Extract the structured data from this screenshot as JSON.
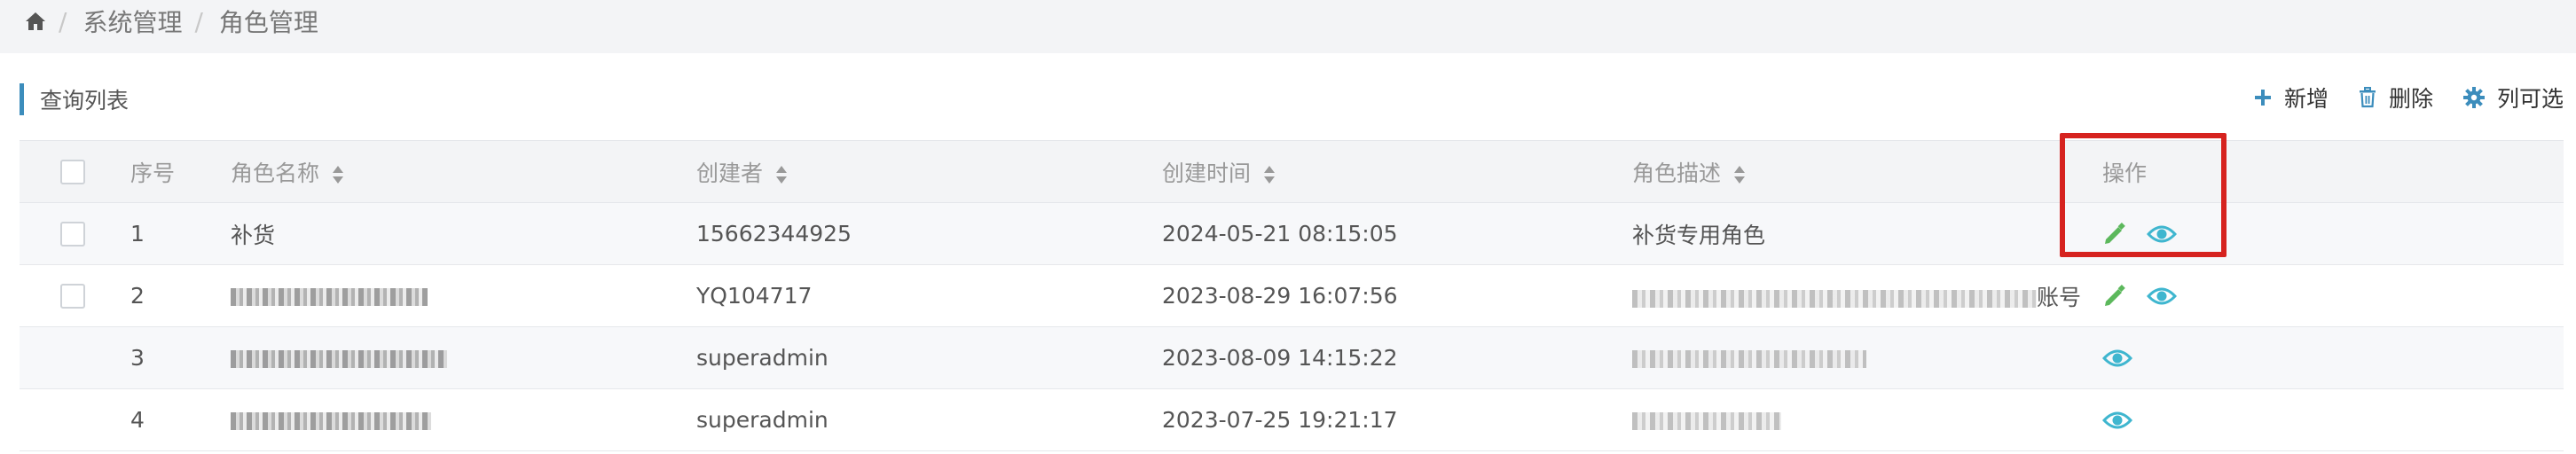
{
  "breadcrumb": {
    "items": [
      "系统管理",
      "角色管理"
    ]
  },
  "panel": {
    "title": "查询列表"
  },
  "toolbar": {
    "add_label": "新增",
    "delete_label": "删除",
    "columns_label": "列可选"
  },
  "table": {
    "headers": {
      "index": "序号",
      "name": "角色名称",
      "creator": "创建者",
      "created_at": "创建时间",
      "description": "角色描述",
      "actions": "操作"
    },
    "rows": [
      {
        "index": "1",
        "name": "补货",
        "creator": "15662344925",
        "created_at": "2024-05-21 08:15:05",
        "description": "补货专用角色"
      },
      {
        "index": "2",
        "name": "",
        "creator": "YQ104717",
        "created_at": "2023-08-29 16:07:56",
        "description": "账号"
      },
      {
        "index": "3",
        "name": "",
        "creator": "superadmin",
        "created_at": "2023-08-09 14:15:22",
        "description": ""
      },
      {
        "index": "4",
        "name": "",
        "creator": "superadmin",
        "created_at": "2023-07-25 19:21:17",
        "description": ""
      }
    ]
  },
  "colors": {
    "accent": "#3c8dbc",
    "edit": "#5cb85c",
    "view": "#3fb6cf",
    "highlight": "#d6231f"
  }
}
